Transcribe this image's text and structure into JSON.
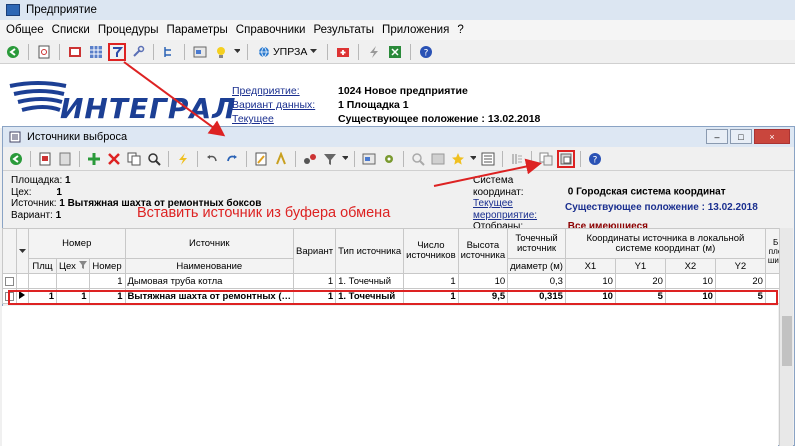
{
  "app": {
    "title": "Предприятие"
  },
  "menu": [
    "Общее",
    "Списки",
    "Процедуры",
    "Параметры",
    "Справочники",
    "Результаты",
    "Приложения",
    "?"
  ],
  "toolbar1": {
    "uprza_label": "УПРЗА"
  },
  "header": {
    "logo_text": "ИНТЕГРАЛ",
    "rows": [
      {
        "label": "Предприятие:",
        "value": "1024 Новое предприятие"
      },
      {
        "label": "Вариант данных:",
        "value": "1 Площадка 1"
      },
      {
        "label": "Текущее мероприятие:",
        "value": "Существующее положение  : 13.02.2018"
      }
    ]
  },
  "inner": {
    "title": "Источники выброса",
    "win_buttons": [
      "–",
      "□",
      "×"
    ],
    "left_info": [
      {
        "label": "Площадка:",
        "value": "1"
      },
      {
        "label": "Цех:",
        "value": "1"
      },
      {
        "label": "Источник:",
        "value": "1  Вытяжная шахта от ремонтных боксов"
      },
      {
        "label": "Вариант:",
        "value": "1"
      }
    ],
    "right_info": [
      {
        "label": "Система координат:",
        "value": "0  Городская система координат"
      },
      {
        "label": "Текущее мероприятие:",
        "value": "Существующее положение  : 13.02.2018"
      },
      {
        "label": "Отобраны:",
        "value": "Все имеющиеся"
      }
    ],
    "annotation": "Вставить источник из буфера обмена"
  },
  "table": {
    "group_headers": {
      "nomer": "Номер",
      "source": "Источник",
      "variant": "Вариант",
      "type": "Тип источника",
      "count": "Число источников",
      "height": "Высота источника",
      "point": "Точечный источник",
      "coords": "Координаты источника в локальной системе координат (м)",
      "extra": "Б пло шир"
    },
    "sub_headers": [
      "Пл",
      "Плщ",
      "Цех",
      "Номер",
      "Наименование",
      "диаметр (м)",
      "X1",
      "Y1",
      "X2",
      "Y2"
    ],
    "rows": [
      {
        "plsh": "",
        "tseh": "",
        "nomer": "1",
        "name": "Дымовая труба котла",
        "variant": "1",
        "type": "1. Точечный",
        "count": "1",
        "height": "10",
        "diam": "0,3",
        "x1": "10",
        "y1": "20",
        "x2": "10",
        "y2": "20"
      },
      {
        "plsh": "1",
        "tseh": "1",
        "nomer": "1",
        "name": "Вытяжная шахта от ремонтных (…",
        "variant": "1",
        "type": "1. Точечный",
        "count": "1",
        "height": "9,5",
        "diam": "0,315",
        "x1": "10",
        "y1": "5",
        "x2": "10",
        "y2": "5"
      }
    ]
  },
  "colors": {
    "accent_red": "#dd2222",
    "logo_blue": "#1c3f94",
    "link_blue": "#1a2f8f",
    "value_red": "#8b0000"
  }
}
